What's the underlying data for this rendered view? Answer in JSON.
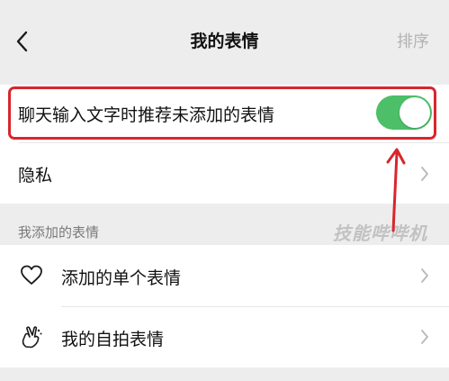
{
  "navbar": {
    "title": "我的表情",
    "action_label": "排序",
    "back_icon": "chevron-left-icon"
  },
  "settings": {
    "recommend_label": "聊天输入文字时推荐未添加的表情",
    "recommend_enabled": true,
    "privacy_label": "隐私"
  },
  "section": {
    "title": "我添加的表情"
  },
  "list": {
    "items": [
      {
        "label": "添加的单个表情",
        "icon": "heart-icon"
      },
      {
        "label": "我的自拍表情",
        "icon": "selfie-hand-icon"
      }
    ]
  },
  "watermark": "技能哔哔机",
  "colors": {
    "accent": "#4cbf68",
    "highlight": "#d8262c",
    "background": "#ededed"
  }
}
